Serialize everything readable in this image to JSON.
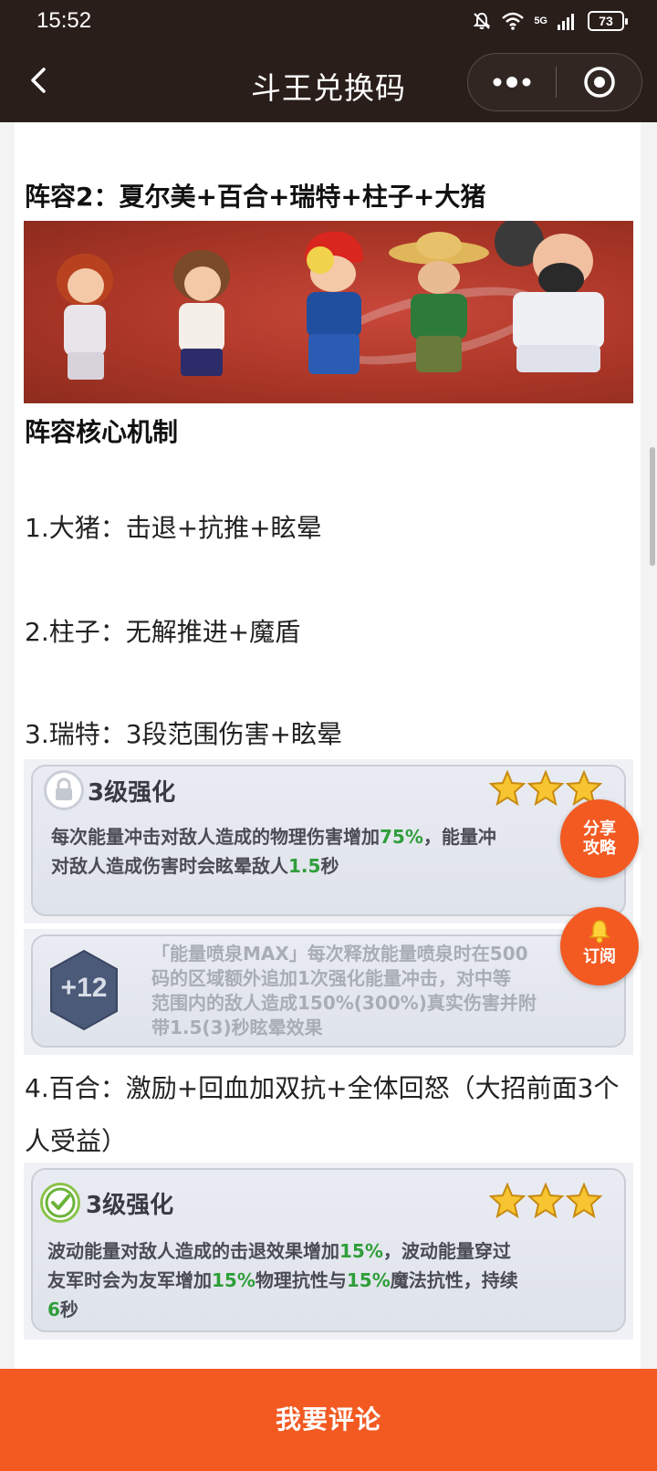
{
  "status_bar": {
    "time": "15:52",
    "network": "5G",
    "battery": "73"
  },
  "header": {
    "title": "斗王兑换码"
  },
  "article": {
    "heading_lineup": "阵容2：夏尔美+百合+瑞特+柱子+大猪",
    "heading_core": "阵容核心机制",
    "items": [
      "1.大猪：击退+抗推+眩晕",
      "2.柱子：无解推进+魔盾",
      "3.瑞特：3段范围伤害+眩晕",
      "4.百合：激励+回血加双抗+全体回怒（大招前面3个人受益）"
    ]
  },
  "card1": {
    "title": "3级强化",
    "line1_a": "每次能量冲击对敌人造成的物理伤害增加",
    "line1_pct": "75%",
    "line1_b": "，能量冲",
    "line2_a": "对敌人造成伤害时会眩晕敌人",
    "line2_sec": "1.5",
    "line2_b": "秒"
  },
  "card2": {
    "badge": "+12",
    "line1": "「能量喷泉MAX」每次释放能量喷泉时在500",
    "line2": "码的区域额外追加1次强化能量冲击，对中等",
    "line3": "范围内的敌人造成150%(300%)真实伤害并附",
    "line4": "带1.5(3)秒眩晕效果"
  },
  "card3": {
    "title": "3级强化",
    "line1_a": "波动能量对敌人造成的击退效果增加",
    "line1_pct": "15%",
    "line1_b": "，波动能量穿过",
    "line2_a": "友军时会为友军增加",
    "line2_pct1": "15%",
    "line2_b": "物理抗性与",
    "line2_pct2": "15%",
    "line2_c": "魔法抗性，持续",
    "line3_num": "6",
    "line3_b": "秒"
  },
  "fab": {
    "share_line1": "分享",
    "share_line2": "攻略",
    "subscribe": "订阅"
  },
  "bottom_bar": {
    "comment": "我要评论"
  },
  "colors": {
    "header_bg": "#2a1e1b",
    "accent": "#f25a22",
    "highlight_green": "#2f9e3a"
  }
}
